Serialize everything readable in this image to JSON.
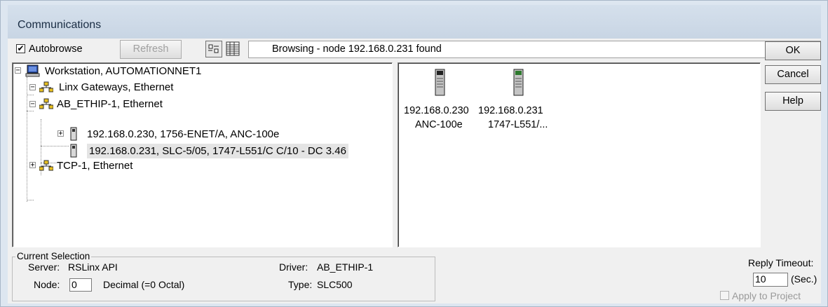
{
  "window": {
    "title": "Communications"
  },
  "toolbar": {
    "autobrowse_label": "Autobrowse",
    "autobrowse_checked": "✔",
    "refresh_label": "Refresh",
    "status_text": "Browsing - node 192.168.0.231 found"
  },
  "buttons": {
    "ok": "OK",
    "cancel": "Cancel",
    "help": "Help"
  },
  "tree": {
    "workstation": "Workstation, AUTOMATIONNET1",
    "linx": "Linx Gateways, Ethernet",
    "abethip": "AB_ETHIP-1, Ethernet",
    "node230": "192.168.0.230, 1756-ENET/A, ANC-100e",
    "node231": "192.168.0.231, SLC-5/05, 1747-L551/C C/10 - DC 3.46",
    "tcp": "TCP-1, Ethernet",
    "expand_minus": "−",
    "expand_plus": "+"
  },
  "devices": [
    {
      "ip": "192.168.0.230",
      "name": "ANC-100e"
    },
    {
      "ip": "192.168.0.231",
      "name": "1747-L551/..."
    }
  ],
  "selection": {
    "legend": "Current Selection",
    "server_label": "Server:",
    "server_value": "RSLinx API",
    "node_label": "Node:",
    "node_value": "0",
    "node_format": "Decimal (=0 Octal)",
    "driver_label": "Driver:",
    "driver_value": "AB_ETHIP-1",
    "type_label": "Type:",
    "type_value": "SLC500"
  },
  "reply": {
    "label": "Reply Timeout:",
    "value": "10",
    "unit": "(Sec.)",
    "apply_label": "Apply to Project"
  }
}
